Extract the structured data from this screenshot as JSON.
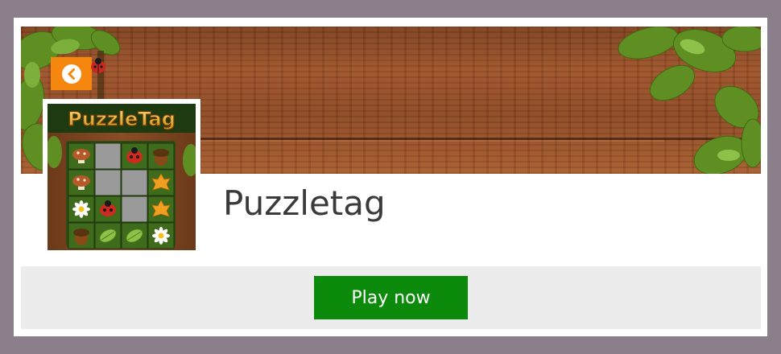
{
  "game": {
    "title": "Puzzletag",
    "thumbnail_logo_text": "PuzzleTag"
  },
  "header": {
    "back_button_icon": "chevron-left-circle-icon"
  },
  "footer": {
    "play_label": "Play now"
  },
  "colors": {
    "page_bg": "#8a7f8a",
    "back_button": "#f5870f",
    "play_button": "#0c8a0c",
    "footer_bg": "#ececec",
    "title_text": "#3a3a3a"
  },
  "thumbnail_grid": [
    [
      "mushroom",
      "empty",
      "ladybug",
      "acorn"
    ],
    [
      "mushroom",
      "empty",
      "empty",
      "maple-leaf"
    ],
    [
      "daisy",
      "ladybug",
      "empty",
      "maple-leaf"
    ],
    [
      "acorn",
      "green-leaf",
      "green-leaf",
      "daisy"
    ]
  ]
}
